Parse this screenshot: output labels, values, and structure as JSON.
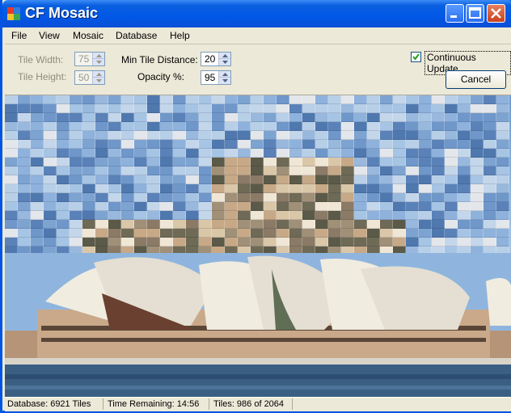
{
  "window": {
    "title": "CF Mosaic",
    "controls": [
      "minimize-icon",
      "maximize-icon",
      "close-icon"
    ]
  },
  "menu": {
    "items": [
      {
        "label": "File"
      },
      {
        "label": "View"
      },
      {
        "label": "Mosaic"
      },
      {
        "label": "Database"
      },
      {
        "label": "Help"
      }
    ]
  },
  "settings": {
    "tile_width": {
      "label": "Tile Width:",
      "value": "75",
      "enabled": false
    },
    "tile_height": {
      "label": "Tile Height:",
      "value": "50",
      "enabled": false
    },
    "min_tile_distance": {
      "label": "Min Tile Distance:",
      "value": "20",
      "enabled": true
    },
    "opacity": {
      "label": "Opacity %:",
      "value": "95",
      "enabled": true
    },
    "continuous_update": {
      "label": "Continuous Update",
      "checked": true
    },
    "cancel_label": "Cancel"
  },
  "status": {
    "database": "Database: 6921 Tiles",
    "time_remaining": "Time Remaining: 14:56",
    "tiles": "Tiles: 986 of 2064"
  },
  "colors": {
    "title_bar": "#0058e6",
    "close_button": "#c8401e",
    "sky": "#8fb5de",
    "sails": "#f0ece0",
    "building": "#c9a98a",
    "water": "#3a5f82"
  }
}
